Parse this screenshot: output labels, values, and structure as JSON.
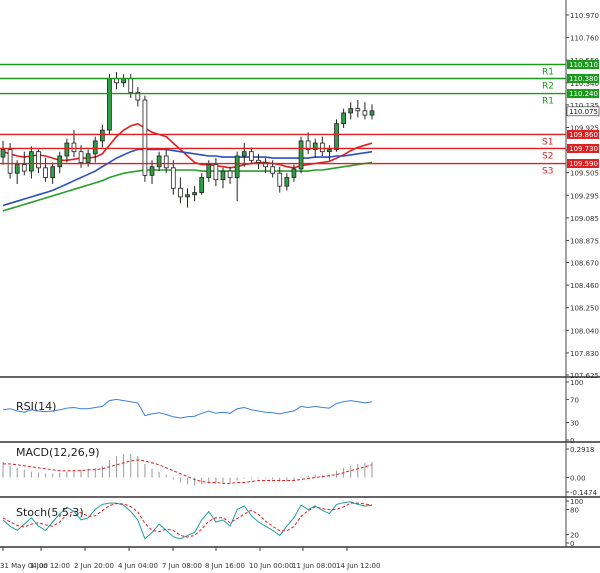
{
  "chart_data": {
    "type": "candlestick",
    "price_axis": {
      "ticks": [
        "110.970",
        "110.760",
        "110.550",
        "110.340",
        "110.135",
        "109.925",
        "109.715",
        "109.505",
        "109.295",
        "109.085",
        "108.875",
        "108.670",
        "108.460",
        "108.250",
        "108.040",
        "107.830",
        "107.625"
      ],
      "ylim": [
        107.625,
        110.97
      ]
    },
    "time_axis": {
      "labels": [
        "31 May 04:00",
        "1 Jun 12:00",
        "2 Jun 20:00",
        "4 Jun 04:00",
        "7 Jun 08:00",
        "8 Jun 16:00",
        "10 Jun 00:00",
        "11 Jun 08:00",
        "14 Jun 12:00"
      ]
    },
    "levels": [
      {
        "name": "R1",
        "value": 110.51,
        "tag": "110.510",
        "color": "#1a9a1a"
      },
      {
        "name": "R2",
        "value": 110.38,
        "tag": "110.380",
        "color": "#1a9a1a"
      },
      {
        "name": "R1",
        "value": 110.24,
        "tag": "110.240",
        "color": "#1a9a1a"
      },
      {
        "name": "S1",
        "value": 109.86,
        "tag": "109.860",
        "color": "#e02020"
      },
      {
        "name": "S2",
        "value": 109.73,
        "tag": "109.730",
        "color": "#e02020"
      },
      {
        "name": "S3",
        "value": 109.59,
        "tag": "109.590",
        "color": "#e02020"
      }
    ],
    "current_price": {
      "value": 110.075,
      "tag": "110.075"
    },
    "candles": [
      [
        109.65,
        109.8,
        109.58,
        109.72
      ],
      [
        109.72,
        109.78,
        109.45,
        109.5
      ],
      [
        109.5,
        109.62,
        109.4,
        109.58
      ],
      [
        109.58,
        109.7,
        109.48,
        109.52
      ],
      [
        109.52,
        109.75,
        109.45,
        109.7
      ],
      [
        109.7,
        109.72,
        109.5,
        109.55
      ],
      [
        109.55,
        109.64,
        109.42,
        109.46
      ],
      [
        109.46,
        109.6,
        109.4,
        109.56
      ],
      [
        109.56,
        109.7,
        109.5,
        109.66
      ],
      [
        109.66,
        109.82,
        109.6,
        109.78
      ],
      [
        109.78,
        109.9,
        109.65,
        109.7
      ],
      [
        109.7,
        109.76,
        109.55,
        109.6
      ],
      [
        109.6,
        109.72,
        109.56,
        109.68
      ],
      [
        109.68,
        109.84,
        109.6,
        109.8
      ],
      [
        109.8,
        109.95,
        109.74,
        109.9
      ],
      [
        109.9,
        110.42,
        109.86,
        110.38
      ],
      [
        110.38,
        110.44,
        110.28,
        110.34
      ],
      [
        110.34,
        110.42,
        110.3,
        110.38
      ],
      [
        110.38,
        110.42,
        110.2,
        110.25
      ],
      [
        110.25,
        110.3,
        110.12,
        110.18
      ],
      [
        110.18,
        110.22,
        109.42,
        109.48
      ],
      [
        109.48,
        109.62,
        109.4,
        109.56
      ],
      [
        109.56,
        109.7,
        109.52,
        109.66
      ],
      [
        109.66,
        109.72,
        109.5,
        109.55
      ],
      [
        109.55,
        109.62,
        109.3,
        109.36
      ],
      [
        109.36,
        109.46,
        109.22,
        109.28
      ],
      [
        109.28,
        109.36,
        109.18,
        109.3
      ],
      [
        109.3,
        109.38,
        109.24,
        109.32
      ],
      [
        109.32,
        109.5,
        109.3,
        109.46
      ],
      [
        109.46,
        109.62,
        109.42,
        109.58
      ],
      [
        109.58,
        109.64,
        109.38,
        109.44
      ],
      [
        109.44,
        109.55,
        109.36,
        109.52
      ],
      [
        109.52,
        109.56,
        109.4,
        109.46
      ],
      [
        109.46,
        109.7,
        109.24,
        109.66
      ],
      [
        109.66,
        109.78,
        109.56,
        109.7
      ],
      [
        109.7,
        109.74,
        109.58,
        109.62
      ],
      [
        109.62,
        109.68,
        109.54,
        109.6
      ],
      [
        109.6,
        109.64,
        109.5,
        109.56
      ],
      [
        109.56,
        109.62,
        109.46,
        109.5
      ],
      [
        109.5,
        109.56,
        109.32,
        109.38
      ],
      [
        109.38,
        109.5,
        109.34,
        109.46
      ],
      [
        109.46,
        109.58,
        109.42,
        109.54
      ],
      [
        109.54,
        109.84,
        109.5,
        109.8
      ],
      [
        109.8,
        109.88,
        109.68,
        109.72
      ],
      [
        109.72,
        109.82,
        109.64,
        109.78
      ],
      [
        109.78,
        109.84,
        109.66,
        109.7
      ],
      [
        109.7,
        109.76,
        109.62,
        109.72
      ],
      [
        109.72,
        110.0,
        109.7,
        109.96
      ],
      [
        109.96,
        110.1,
        109.92,
        110.06
      ],
      [
        110.06,
        110.16,
        110.0,
        110.1
      ],
      [
        110.1,
        110.18,
        110.02,
        110.08
      ],
      [
        110.08,
        110.16,
        110.0,
        110.04
      ],
      [
        110.04,
        110.14,
        110.0,
        110.08
      ]
    ],
    "moving_averages": [
      {
        "color": "#e02020",
        "values": [
          109.7,
          109.68,
          109.66,
          109.65,
          109.66,
          109.67,
          109.66,
          109.64,
          109.62,
          109.62,
          109.63,
          109.64,
          109.64,
          109.65,
          109.68,
          109.76,
          109.84,
          109.9,
          109.94,
          109.96,
          109.92,
          109.88,
          109.86,
          109.84,
          109.78,
          109.72,
          109.66,
          109.6,
          109.58,
          109.58,
          109.57,
          109.56,
          109.55,
          109.56,
          109.58,
          109.59,
          109.6,
          109.6,
          109.59,
          109.58,
          109.56,
          109.55,
          109.57,
          109.58,
          109.59,
          109.6,
          109.61,
          109.64,
          109.67,
          109.71,
          109.74,
          109.76,
          109.78
        ]
      },
      {
        "color": "#2b4fc0",
        "values": [
          109.2,
          109.22,
          109.24,
          109.26,
          109.28,
          109.3,
          109.32,
          109.34,
          109.37,
          109.4,
          109.43,
          109.46,
          109.49,
          109.52,
          109.56,
          109.6,
          109.64,
          109.67,
          109.7,
          109.72,
          109.72,
          109.72,
          109.72,
          109.72,
          109.71,
          109.7,
          109.69,
          109.68,
          109.67,
          109.66,
          109.66,
          109.65,
          109.65,
          109.65,
          109.65,
          109.65,
          109.65,
          109.65,
          109.64,
          109.64,
          109.64,
          109.64,
          109.64,
          109.64,
          109.65,
          109.65,
          109.65,
          109.66,
          109.66,
          109.67,
          109.68,
          109.69,
          109.7
        ]
      },
      {
        "color": "#2aa02a",
        "values": [
          109.15,
          109.17,
          109.19,
          109.21,
          109.23,
          109.25,
          109.27,
          109.29,
          109.31,
          109.33,
          109.35,
          109.37,
          109.39,
          109.41,
          109.43,
          109.46,
          109.48,
          109.5,
          109.51,
          109.52,
          109.53,
          109.53,
          109.53,
          109.53,
          109.53,
          109.53,
          109.53,
          109.53,
          109.52,
          109.52,
          109.52,
          109.52,
          109.52,
          109.52,
          109.52,
          109.52,
          109.52,
          109.52,
          109.52,
          109.52,
          109.52,
          109.52,
          109.52,
          109.52,
          109.53,
          109.53,
          109.54,
          109.55,
          109.56,
          109.57,
          109.58,
          109.59,
          109.6
        ]
      }
    ],
    "rsi": {
      "label": "RSI(14)",
      "ticks": [
        "100",
        "70",
        "30",
        "0"
      ],
      "values": [
        52,
        54,
        50,
        48,
        52,
        50,
        49,
        50,
        52,
        55,
        56,
        54,
        54,
        56,
        58,
        68,
        70,
        68,
        66,
        64,
        42,
        45,
        47,
        44,
        40,
        38,
        40,
        41,
        46,
        50,
        46,
        48,
        46,
        54,
        56,
        52,
        50,
        48,
        47,
        45,
        48,
        50,
        58,
        56,
        58,
        56,
        55,
        63,
        66,
        68,
        66,
        64,
        66
      ]
    },
    "macd": {
      "label": "MACD(12,26,9)",
      "ticks": [
        "0.2918",
        "0.00",
        "-0.1474"
      ],
      "histogram": [
        0.16,
        0.12,
        0.1,
        0.08,
        0.06,
        0.05,
        0.04,
        0.04,
        0.05,
        0.06,
        0.08,
        0.08,
        0.09,
        0.1,
        0.12,
        0.18,
        0.22,
        0.24,
        0.24,
        0.22,
        0.14,
        0.09,
        0.06,
        0.03,
        -0.02,
        -0.05,
        -0.07,
        -0.08,
        -0.07,
        -0.06,
        -0.06,
        -0.06,
        -0.06,
        -0.03,
        -0.01,
        -0.01,
        -0.01,
        -0.01,
        -0.02,
        -0.04,
        -0.04,
        -0.03,
        0.01,
        0.02,
        0.03,
        0.03,
        0.03,
        0.07,
        0.1,
        0.12,
        0.14,
        0.15,
        0.16
      ],
      "signal": [
        0.14,
        0.14,
        0.13,
        0.12,
        0.11,
        0.1,
        0.09,
        0.08,
        0.07,
        0.07,
        0.07,
        0.07,
        0.08,
        0.08,
        0.09,
        0.11,
        0.13,
        0.15,
        0.17,
        0.18,
        0.17,
        0.15,
        0.13,
        0.1,
        0.07,
        0.04,
        0.01,
        -0.02,
        -0.04,
        -0.05,
        -0.05,
        -0.06,
        -0.06,
        -0.05,
        -0.05,
        -0.04,
        -0.03,
        -0.03,
        -0.03,
        -0.03,
        -0.03,
        -0.03,
        -0.02,
        -0.01,
        0.0,
        0.01,
        0.02,
        0.03,
        0.05,
        0.07,
        0.09,
        0.11,
        0.13
      ]
    },
    "stoch": {
      "label": "Stoch(5,5,3)",
      "ticks": [
        "100",
        "80",
        "20",
        "0"
      ],
      "k": [
        55,
        40,
        30,
        45,
        60,
        40,
        30,
        50,
        70,
        85,
        75,
        55,
        60,
        80,
        92,
        95,
        95,
        90,
        75,
        55,
        10,
        25,
        45,
        30,
        15,
        10,
        18,
        25,
        55,
        75,
        50,
        55,
        40,
        80,
        88,
        65,
        50,
        40,
        30,
        18,
        40,
        60,
        90,
        80,
        88,
        78,
        70,
        92,
        96,
        98,
        92,
        88,
        90
      ],
      "d": [
        60,
        50,
        42,
        38,
        45,
        48,
        43,
        40,
        50,
        68,
        76,
        72,
        63,
        65,
        77,
        89,
        94,
        93,
        87,
        74,
        47,
        30,
        27,
        33,
        30,
        18,
        14,
        18,
        33,
        52,
        60,
        60,
        48,
        58,
        69,
        78,
        68,
        52,
        40,
        29,
        29,
        39,
        63,
        77,
        86,
        82,
        79,
        80,
        86,
        95,
        95,
        93,
        90
      ]
    }
  }
}
